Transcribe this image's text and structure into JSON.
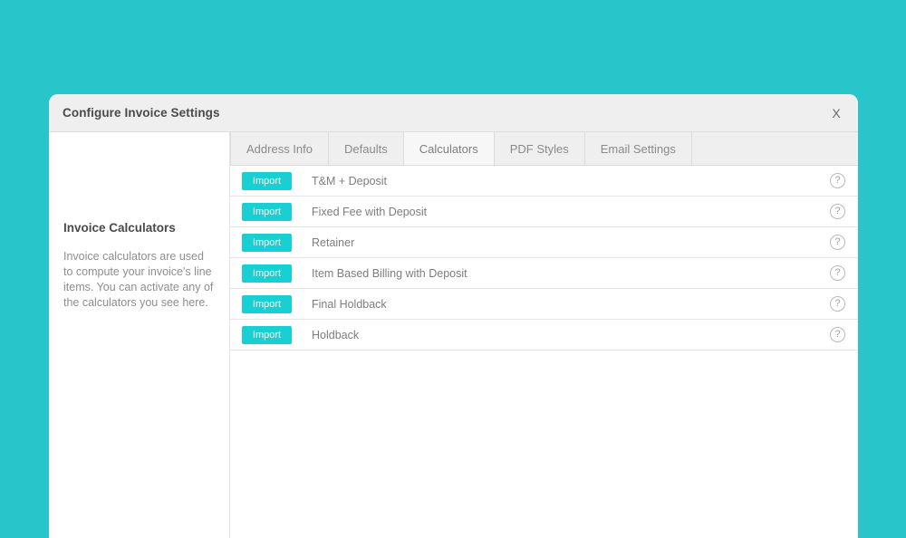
{
  "page": {
    "background_color": "#28c5cb"
  },
  "modal": {
    "title": "Configure Invoice Settings",
    "close_label": "X"
  },
  "sidebar": {
    "heading": "Invoice Calculators",
    "description": "Invoice calculators are used to compute your invoice's line items. You can activate any of the calculators you see here."
  },
  "tabs": [
    {
      "label": "Address Info",
      "active": false
    },
    {
      "label": "Defaults",
      "active": false
    },
    {
      "label": "Calculators",
      "active": true
    },
    {
      "label": "PDF Styles",
      "active": false
    },
    {
      "label": "Email Settings",
      "active": false
    }
  ],
  "calculators": {
    "import_label": "Import",
    "help_label": "?",
    "rows": [
      {
        "name": "T&M + Deposit"
      },
      {
        "name": "Fixed Fee with Deposit"
      },
      {
        "name": "Retainer"
      },
      {
        "name": "Item Based Billing with Deposit"
      },
      {
        "name": "Final Holdback"
      },
      {
        "name": "Holdback"
      }
    ]
  },
  "colors": {
    "accent_teal": "#28c5cb",
    "button_teal": "#18cfd3",
    "header_grey": "#efefef",
    "text_grey": "#7d7d7d"
  }
}
